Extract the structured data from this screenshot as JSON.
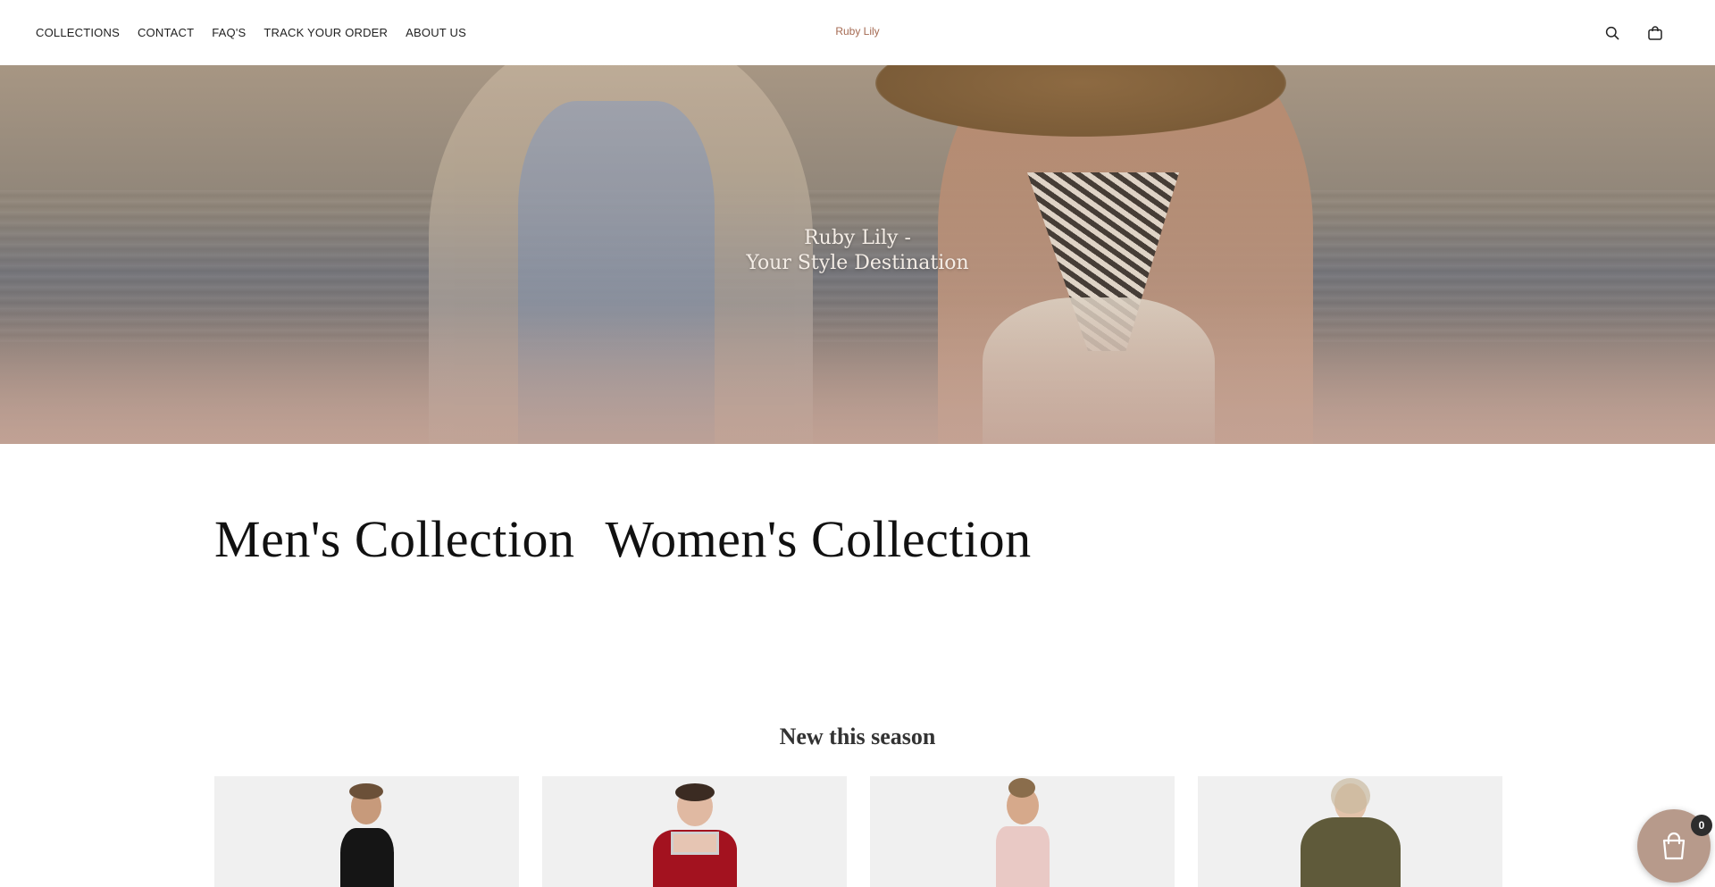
{
  "header": {
    "nav": [
      {
        "label": "COLLECTIONS"
      },
      {
        "label": "CONTACT"
      },
      {
        "label": "FAQ'S"
      },
      {
        "label": "TRACK YOUR ORDER"
      },
      {
        "label": "ABOUT US"
      }
    ],
    "brand": "Ruby Lily",
    "icons": [
      "search-icon",
      "bag-icon"
    ]
  },
  "hero": {
    "line1": "Ruby Lily -",
    "line2": "Your Style Destination"
  },
  "collections": {
    "men": "Men's Collection",
    "women": "Women's Collection"
  },
  "new_season": {
    "title": "New this season"
  },
  "cart": {
    "count": "0"
  },
  "colors": {
    "brand": "#a56a52",
    "card_bg": "#f0f0f0",
    "float_cart": "#b79a8b"
  }
}
